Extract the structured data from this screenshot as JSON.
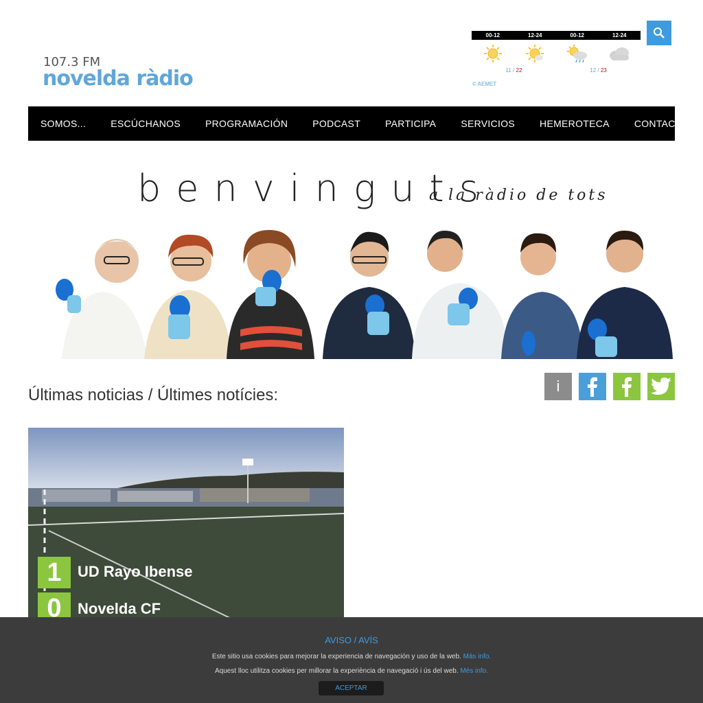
{
  "header": {
    "frequency": "107.3 FM",
    "brand": "novelda ràdio"
  },
  "weather": {
    "columns": [
      "00-12",
      "12-24",
      "00-12",
      "12-24"
    ],
    "icons": [
      "sun-icon",
      "sun-icon",
      "sun-rain-icon",
      "cloud-icon"
    ],
    "day1_min": "11",
    "day1_max": "22",
    "day2_min": "12",
    "day2_max": "23",
    "credit": "© AEMET"
  },
  "nav": {
    "items": [
      "SOMOS...",
      "ESCÚCHANOS",
      "PROGRAMACIÓN",
      "PODCAST",
      "PARTICIPA",
      "SERVICIOS",
      "HEMEROTECA",
      "CONTACTO"
    ]
  },
  "banner": {
    "title": "benvinguts",
    "subtitle": "a la ràdio de tots"
  },
  "news": {
    "heading": "Últimas noticias / Últimes notícies:",
    "card": {
      "score1": "1",
      "team1": "UD Rayo Ibense",
      "score2": "0",
      "team2": "Novelda CF"
    }
  },
  "social": {
    "info": "i"
  },
  "cookie": {
    "title": "AVISO / AVÍS",
    "line1": "Este sitio usa cookies para mejorar la experiencia de navegación y uso de la web.",
    "line1_link": "Más info.",
    "line2": "Aquest lloc utilitza cookies per millorar la experiència de navegació i ús del web.",
    "line2_link": "Més info.",
    "accept": "ACEPTAR"
  },
  "colors": {
    "accent_blue": "#3f9be0",
    "logo_blue": "#5fa7d9",
    "score_green": "#8cc63f",
    "facebook_light": "#4b9fd9",
    "facebook_green": "#8cc63f",
    "twitter_green": "#8cc63f"
  }
}
